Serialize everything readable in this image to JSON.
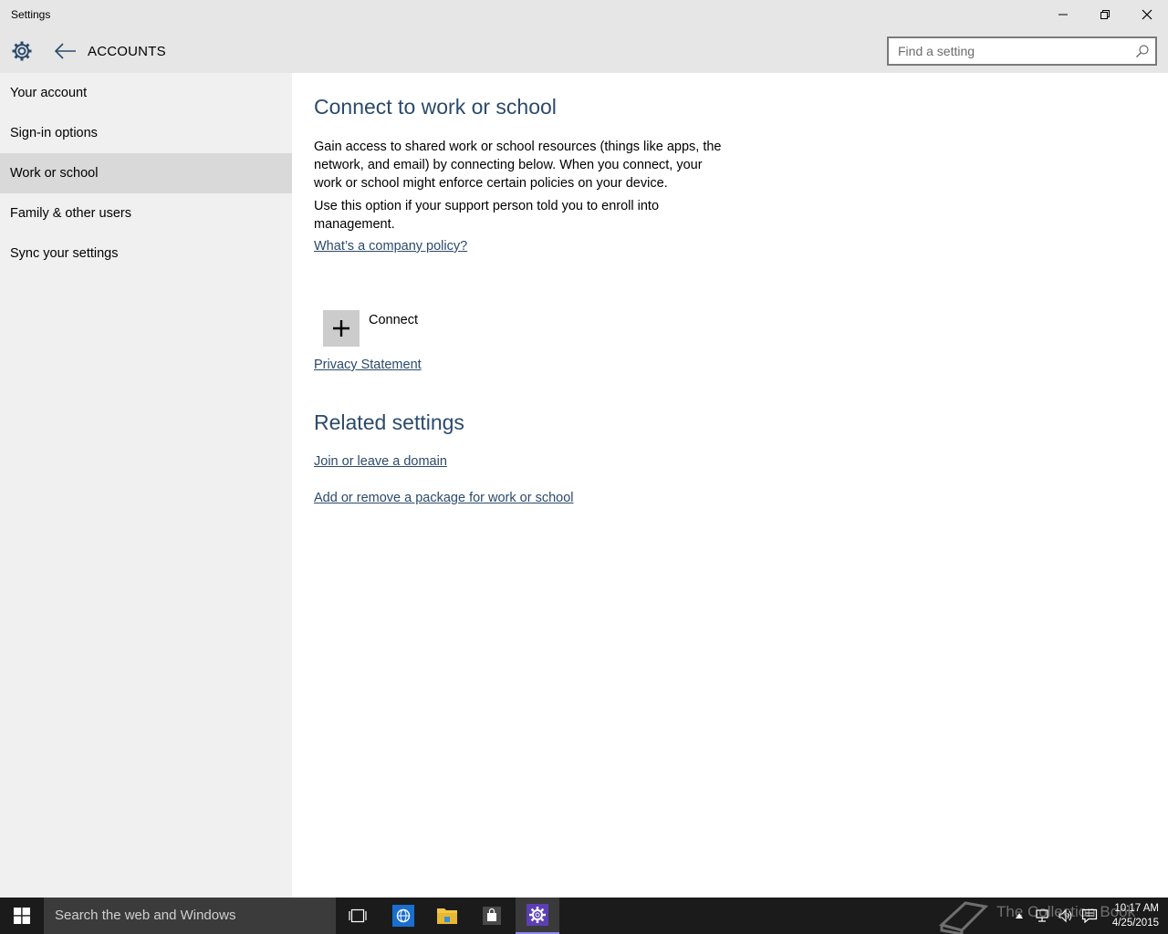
{
  "window": {
    "title": "Settings"
  },
  "header": {
    "section_title": "ACCOUNTS",
    "search_placeholder": "Find a setting"
  },
  "sidebar": {
    "items": [
      {
        "label": "Your account"
      },
      {
        "label": "Sign-in options"
      },
      {
        "label": "Work or school",
        "selected": true
      },
      {
        "label": "Family & other users"
      },
      {
        "label": "Sync your settings"
      }
    ]
  },
  "main": {
    "heading": "Connect to work or school",
    "description_1": "Gain access to shared work or school resources (things like apps, the network, and email) by connecting below. When you connect, your work or school might enforce certain policies on your device.",
    "description_2": "Use this option if your support person told you to enroll into management.",
    "policy_link": "What’s a company policy?",
    "connect_label": "Connect",
    "privacy_link": "Privacy Statement",
    "related_heading": "Related settings",
    "related_links": [
      {
        "label": "Join or leave a domain"
      },
      {
        "label": "Add or remove a package for work or school"
      }
    ]
  },
  "taskbar": {
    "search_placeholder": "Search the web and Windows",
    "watermark": "The Collection Book",
    "time": "10:17 AM",
    "date": "4/25/2015"
  },
  "colors": {
    "accent": "#2b4a6b",
    "taskbar": "#1b1b1b",
    "sidebar_bg": "#f0f0f0",
    "selected_bg": "#d9d9d9",
    "settings_active": "#5c3fb5"
  },
  "icons": {
    "header": [
      "gear-icon",
      "back-arrow-icon",
      "search-icon"
    ],
    "window_controls": [
      "minimize-icon",
      "maximize-icon",
      "close-icon"
    ],
    "taskbar": [
      "windows-logo-icon",
      "task-view-icon",
      "internet-explorer-icon",
      "file-explorer-icon",
      "store-icon",
      "settings-gear-icon",
      "show-hidden-icons-icon",
      "network-icon",
      "volume-icon",
      "action-center-icon"
    ]
  }
}
